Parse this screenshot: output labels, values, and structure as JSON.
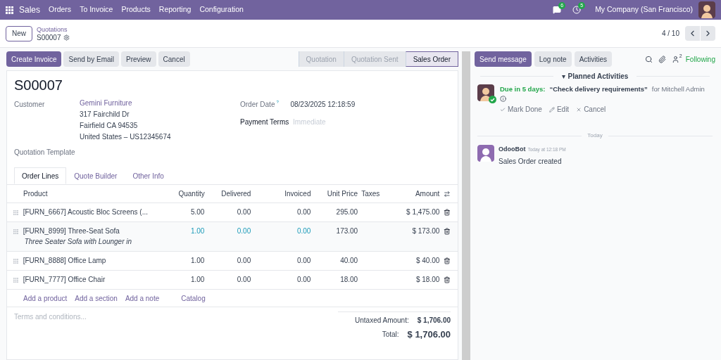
{
  "navbar": {
    "app": "Sales",
    "menu": [
      "Orders",
      "To Invoice",
      "Products",
      "Reporting",
      "Configuration"
    ],
    "messages_count": "6",
    "activities_count": "5",
    "company": "My Company (San Francisco)"
  },
  "control_panel": {
    "new_button": "New",
    "breadcrumb": "Quotations",
    "record": "S00007",
    "pager": "4 / 10"
  },
  "actions": [
    "Create Invoice",
    "Send by Email",
    "Preview",
    "Cancel"
  ],
  "stages": [
    {
      "label": "Quotation",
      "selected": false
    },
    {
      "label": "Quotation Sent",
      "selected": false
    },
    {
      "label": "Sales Order",
      "selected": true
    }
  ],
  "form": {
    "title": "S00007",
    "customer_label": "Customer",
    "customer": "Gemini Furniture",
    "address": [
      "317 Fairchild Dr",
      "Fairfield CA 94535",
      "United States – US12345674"
    ],
    "template_label": "Quotation Template",
    "order_date_label": "Order Date",
    "order_date_help": "?",
    "order_date": "08/23/2025 12:18:59",
    "payment_terms_label": "Payment Terms",
    "payment_terms_placeholder": "Immediate"
  },
  "tabs": [
    {
      "label": "Order Lines",
      "selected": true
    },
    {
      "label": "Quote Builder",
      "selected": false
    },
    {
      "label": "Other Info",
      "selected": false
    }
  ],
  "table": {
    "columns": [
      "Product",
      "Quantity",
      "Delivered",
      "Invoiced",
      "Unit Price",
      "Taxes",
      "Amount"
    ],
    "rows": [
      {
        "product": "[FURN_6667] Acoustic Bloc Screens (...",
        "quantity": "5.00",
        "delivered": "0.00",
        "invoiced": "0.00",
        "unit_price": "295.00",
        "amount": "$ 1,475.00",
        "highlighted": false
      },
      {
        "product": "[FURN_8999] Three-Seat Sofa",
        "description": "Three Seater Sofa with Lounger in",
        "quantity": "1.00",
        "delivered": "0.00",
        "invoiced": "0.00",
        "unit_price": "173.00",
        "amount": "$ 173.00",
        "highlighted": true
      },
      {
        "product": "[FURN_8888] Office Lamp",
        "quantity": "1.00",
        "delivered": "0.00",
        "invoiced": "0.00",
        "unit_price": "40.00",
        "amount": "$ 40.00",
        "highlighted": false
      },
      {
        "product": "[FURN_7777] Office Chair",
        "quantity": "1.00",
        "delivered": "0.00",
        "invoiced": "0.00",
        "unit_price": "18.00",
        "amount": "$ 18.00",
        "highlighted": false
      }
    ],
    "add_links": [
      "Add a product",
      "Add a section",
      "Add a note",
      "Catalog"
    ]
  },
  "terms_placeholder": "Terms and conditions...",
  "totals": {
    "untaxed_label": "Untaxed Amount:",
    "untaxed": "$ 1,706.00",
    "total_label": "Total:",
    "total": "$ 1,706.00"
  },
  "chatter": {
    "buttons": [
      {
        "label": "Send message",
        "selected": true
      },
      {
        "label": "Log note",
        "selected": false
      },
      {
        "label": "Activities",
        "selected": false
      }
    ],
    "followers_count": "2",
    "following": "Following",
    "planned_toggle": "▾",
    "planned_title": "Planned Activities",
    "activity": {
      "due": "Due in 5 days:",
      "summary": "“Check delivery requirements”",
      "assignee": "for Mitchell Admin",
      "actions": [
        "Mark Done",
        "Edit",
        "Cancel"
      ]
    },
    "separator": "Today",
    "message": {
      "author": "OdooBot",
      "time": "Today at 12:18 PM",
      "body": "Sales Order created"
    }
  }
}
